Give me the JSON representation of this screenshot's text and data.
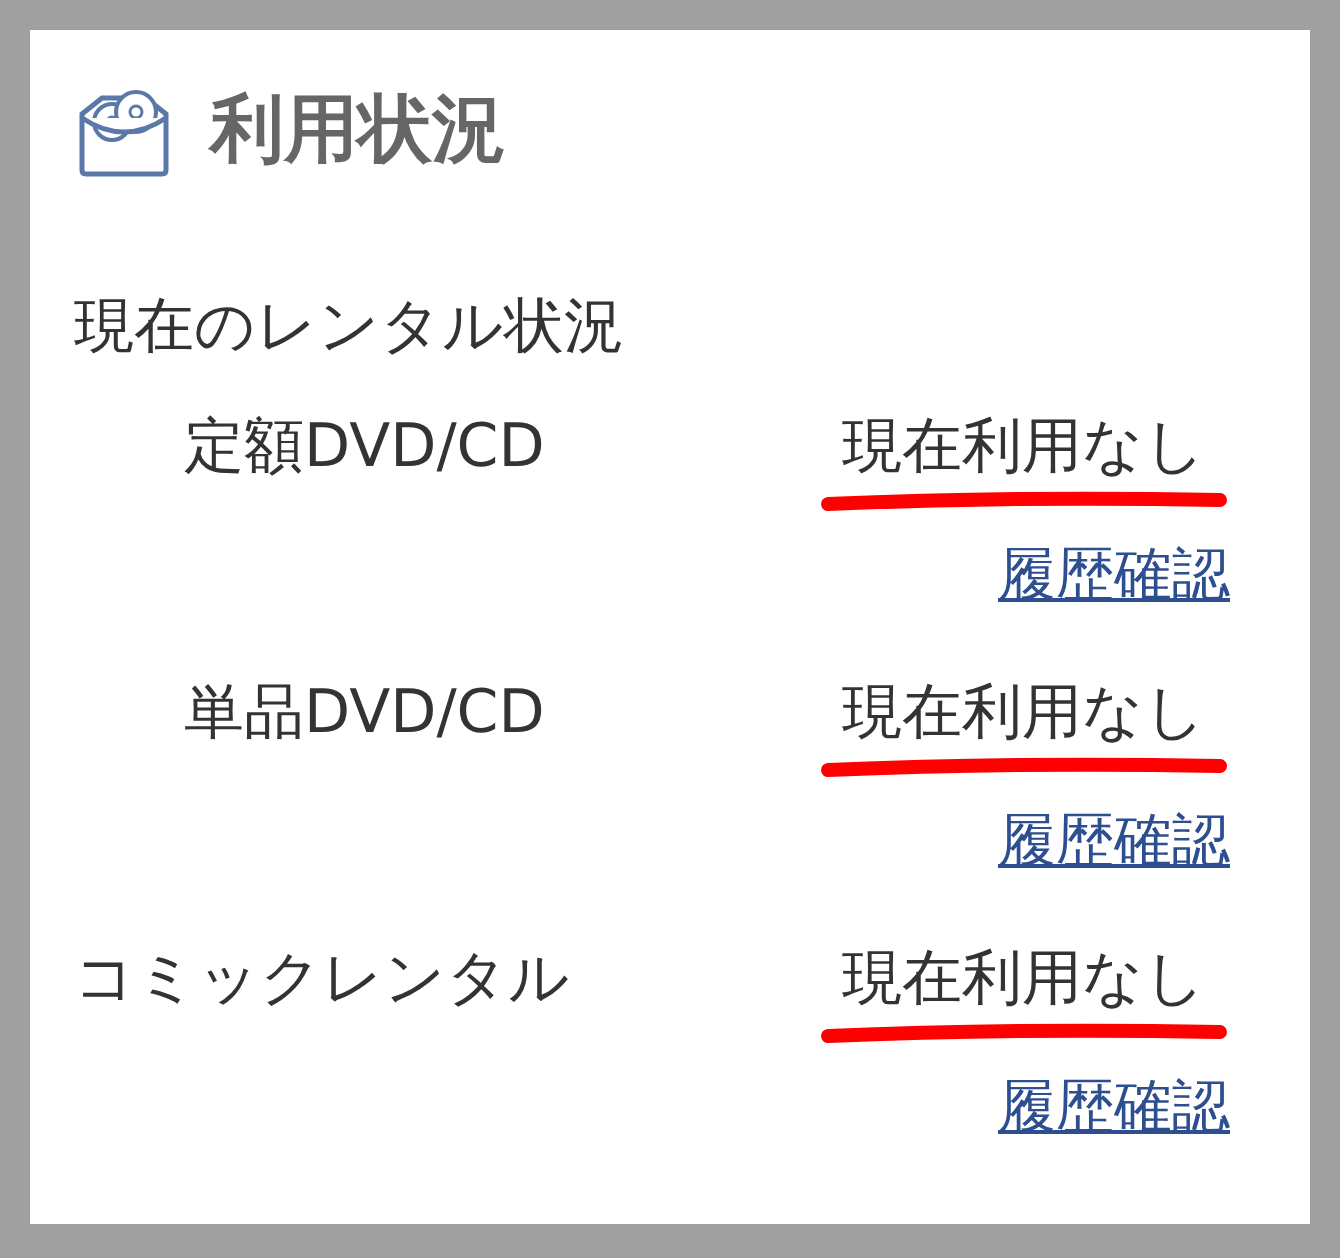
{
  "title": "利用状況",
  "section_heading": "現在のレンタル状況",
  "rows": [
    {
      "label": "定額DVD/CD",
      "indented": true,
      "status": "現在利用なし",
      "underlined": true,
      "link": "履歴確認"
    },
    {
      "label": "単品DVD/CD",
      "indented": true,
      "status": "現在利用なし",
      "underlined": true,
      "link": "履歴確認"
    },
    {
      "label": "コミックレンタル",
      "indented": false,
      "status": "現在利用なし",
      "underlined": true,
      "link": "履歴確認"
    }
  ]
}
